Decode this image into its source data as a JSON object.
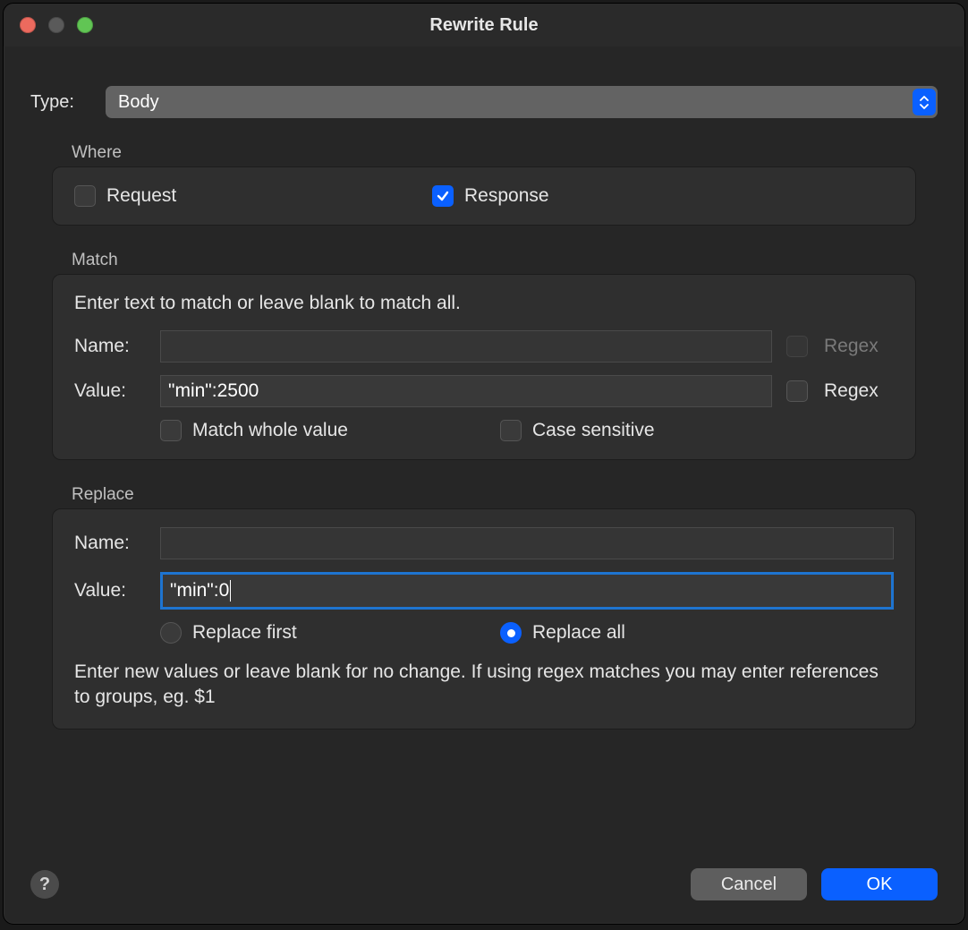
{
  "window": {
    "title": "Rewrite Rule"
  },
  "type": {
    "label": "Type:",
    "value": "Body"
  },
  "where": {
    "section": "Where",
    "request": {
      "label": "Request",
      "checked": false
    },
    "response": {
      "label": "Response",
      "checked": true
    }
  },
  "match": {
    "section": "Match",
    "hint": "Enter text to match or leave blank to match all.",
    "name_label": "Name:",
    "name_value": "",
    "name_regex": {
      "label": "Regex",
      "checked": false
    },
    "value_label": "Value:",
    "value_value": "\"min\":2500",
    "value_regex": {
      "label": "Regex",
      "checked": false
    },
    "whole_value": {
      "label": "Match whole value",
      "checked": false
    },
    "case_sensitive": {
      "label": "Case sensitive",
      "checked": false
    }
  },
  "replace": {
    "section": "Replace",
    "name_label": "Name:",
    "name_value": "",
    "value_label": "Value:",
    "value_value": "\"min\":0",
    "first": {
      "label": "Replace first",
      "selected": false
    },
    "all": {
      "label": "Replace all",
      "selected": true
    },
    "hint": "Enter new values or leave blank for no change. If using regex matches you may enter references to groups, eg. $1"
  },
  "footer": {
    "help": "?",
    "cancel": "Cancel",
    "ok": "OK"
  }
}
